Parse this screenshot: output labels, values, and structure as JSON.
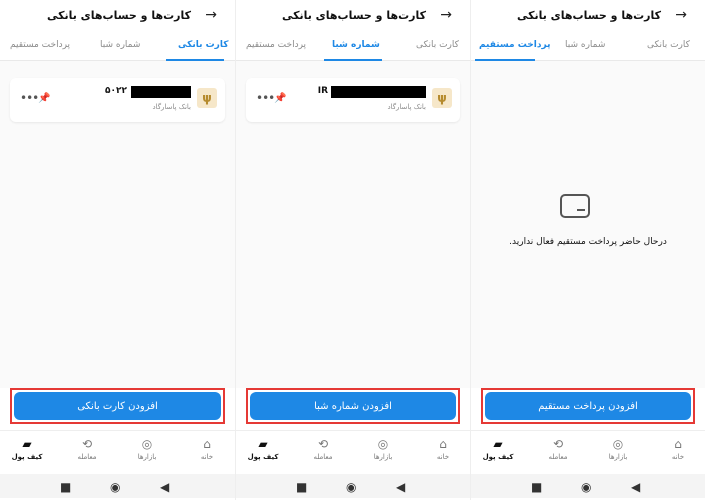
{
  "screens": [
    {
      "header_title": "کارت‌ها و حساب‌های بانکی",
      "tabs": [
        "پرداخت مستقیم",
        "شماره شبا",
        "کارت بانکی"
      ],
      "active_tab": "کارت بانکی",
      "card": {
        "number_prefix": "۵۰۲۲",
        "bank_name": "بانک پاسارگاد"
      },
      "empty_text": "",
      "button_label": "افزودن کارت بانکی"
    },
    {
      "header_title": "کارت‌ها و حساب‌های بانکی",
      "tabs": [
        "پرداخت مستقیم",
        "شماره شبا",
        "کارت بانکی"
      ],
      "active_tab": "شماره شبا",
      "card": {
        "number_prefix": "IR",
        "bank_name": "بانک پاسارگاد"
      },
      "empty_text": "",
      "button_label": "افزودن شماره شبا"
    },
    {
      "header_title": "کارت‌ها و حساب‌های بانکی",
      "tabs": [
        "پرداخت مستقیم",
        "شماره شبا",
        "کارت بانکی"
      ],
      "active_tab": "پرداخت مستقیم",
      "card": null,
      "empty_text": "درحال حاضر پرداخت مستقیم فعال ندارید.",
      "button_label": "افزودن پرداخت مستقیم"
    }
  ],
  "bottom_nav": [
    {
      "label": "کیف پول",
      "icon": "wallet-icon",
      "active": true
    },
    {
      "label": "معامله",
      "icon": "trade-icon",
      "active": false
    },
    {
      "label": "بازارها",
      "icon": "markets-icon",
      "active": false
    },
    {
      "label": "خانه",
      "icon": "home-icon",
      "active": false
    }
  ],
  "system_nav": [
    "recent-apps-icon",
    "home-circle-icon",
    "back-triangle-icon"
  ],
  "colors": {
    "accent": "#1e88e5",
    "highlight": "#e53935",
    "bank_logo": "#f6e7c9"
  }
}
